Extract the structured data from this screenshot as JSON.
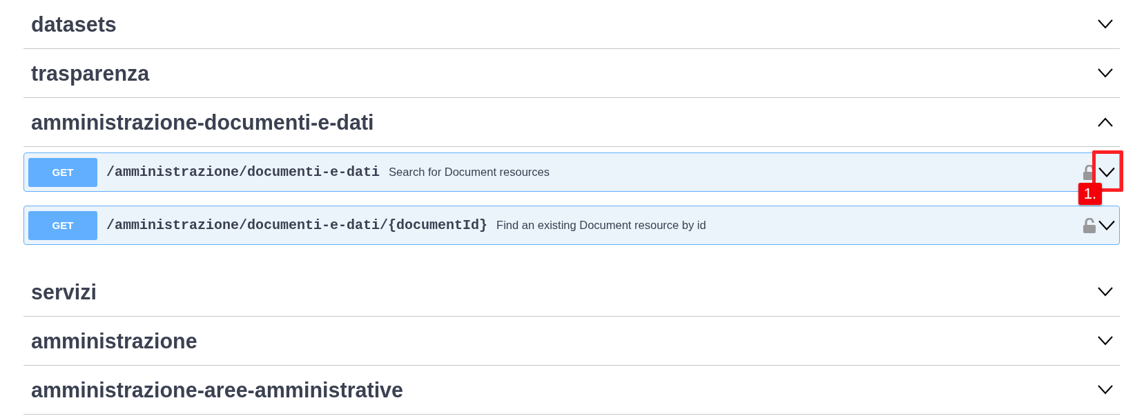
{
  "sections": [
    {
      "name": "datasets",
      "expanded": false
    },
    {
      "name": "trasparenza",
      "expanded": false
    },
    {
      "name": "amministrazione-documenti-e-dati",
      "expanded": true,
      "operations": [
        {
          "method": "GET",
          "path": "/amministrazione/documenti-e-dati",
          "summary": "Search for Document resources",
          "expanded": false,
          "annotation": "1."
        },
        {
          "method": "GET",
          "path": "/amministrazione/documenti-e-dati/{documentId}",
          "summary": "Find an existing Document resource by id",
          "expanded": false
        }
      ]
    },
    {
      "name": "servizi",
      "expanded": false
    },
    {
      "name": "amministrazione",
      "expanded": false
    },
    {
      "name": "amministrazione-aree-amministrative",
      "expanded": false
    }
  ]
}
